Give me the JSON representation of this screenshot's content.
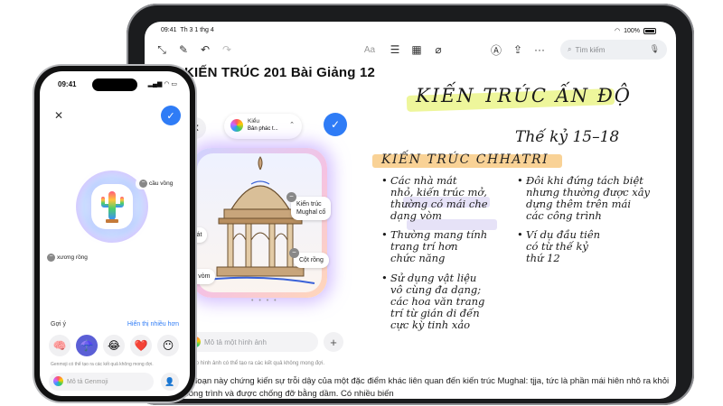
{
  "ipad": {
    "status": {
      "time": "09:41",
      "date": "Th 3 1 thg 4",
      "battery": "100%"
    },
    "toolbar": {
      "icons": [
        "collapse-icon",
        "compose-icon",
        "undo-icon",
        "redo-icon",
        "text-format-icon",
        "checklist-icon",
        "table-icon",
        "attachment-icon",
        "markup-icon",
        "share-icon",
        "more-icon"
      ],
      "format_label": "Aa",
      "search_placeholder": "Tìm kiếm"
    },
    "note_title": "KIẾN TRÚC 201 Bài Giảng 12",
    "handwriting": {
      "title": "KIẾN TRÚC ẤN ĐỘ",
      "subtitle": "Thế kỷ 15–18",
      "section": "KIẾN TRÚC CHHATRI",
      "left_notes": [
        "Các nhà mát\nnhỏ, kiến trúc mở,\nthường có mái che\ndạng vòm",
        "Thường mang tính\ntrang trí hơn\nchức năng",
        "Sử dụng vật liệu\nvô cùng đa dạng;\ncác hoa văn trang\ntrí từ gián di đến\ncực kỳ tinh xảo"
      ],
      "right_notes": [
        "Đôi khi đứng tách biệt\nnhưng thường được xây\ndựng thêm trên mái\ncác công trình",
        "Ví dụ đầu tiên\ncó từ thế kỷ\nthứ 12"
      ]
    },
    "playground": {
      "style_label": "Kiểu",
      "style_value": "Bản phác t...",
      "chips": [
        "Kiến trúc\nMughal cổ",
        "hà mát",
        "Cột rồng",
        "Mái vòm"
      ],
      "pager": "• • • •",
      "describe_placeholder": "Mô tả một hình ảnh",
      "disclaimer": "Đủa phép hình ảnh có thể tạo ra các kết quả không mong đợi."
    },
    "body_text": "ử đoạn này chứng kiến sự trỗi dậy của một đặc điểm khác liên quan đến kiến trúc Mughal: tjja, tức là phần mái hiên nhô ra khỏi công trình và được chống đỡ bằng dầm. Có nhiều biến"
  },
  "iphone": {
    "time": "09:41",
    "chips": [
      "cầu vồng",
      "xương rồng"
    ],
    "suggestions_label": "Gợi ý",
    "show_more": "Hiển thị nhiều hơn",
    "suggestions": [
      "🧠",
      "☂️",
      "😂",
      "❤️",
      "😶"
    ],
    "beta_note": "Genmoji có thể tạo ra các kết quả không mong đợi.",
    "input_placeholder": "Mô tả Genmoji"
  }
}
